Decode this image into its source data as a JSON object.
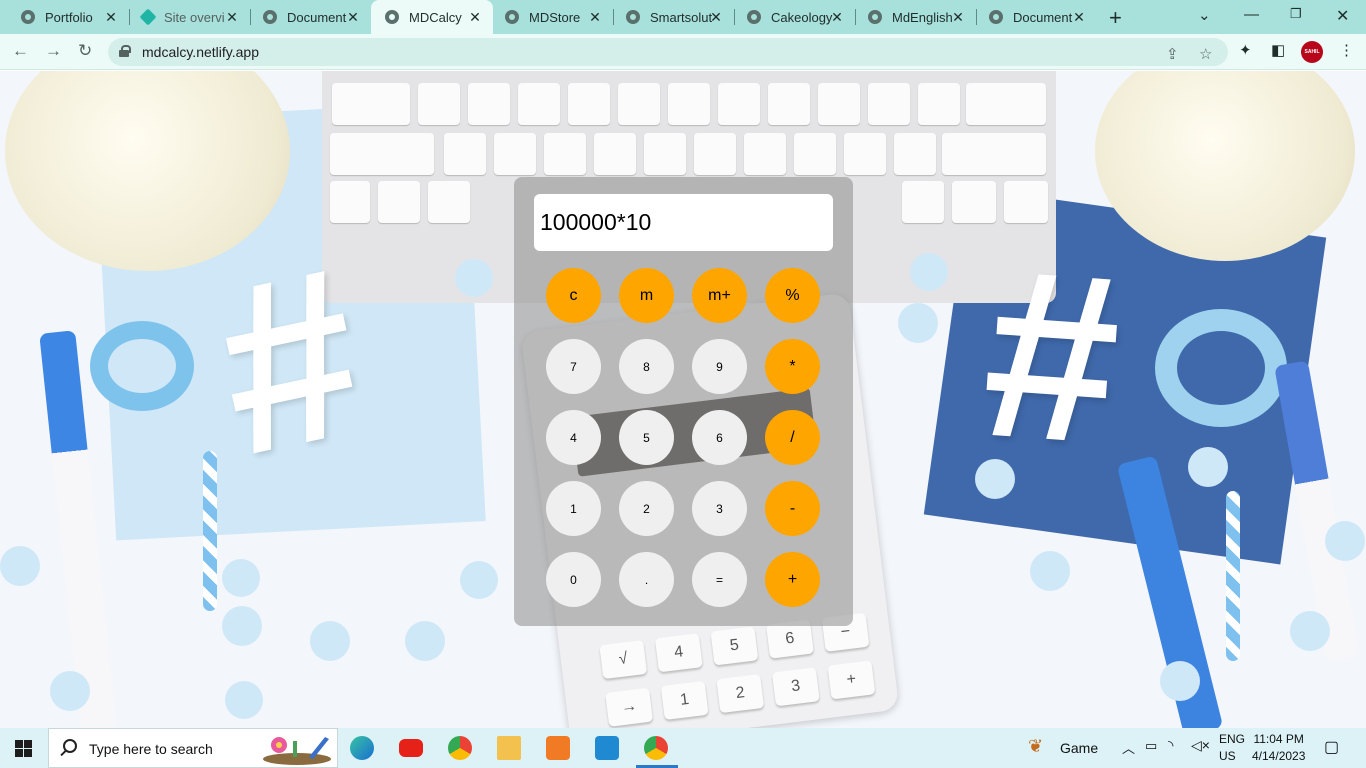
{
  "browser": {
    "tabs": [
      {
        "title": "Portfolio",
        "icon": "globe-icon",
        "active": false
      },
      {
        "title": "Site overvi",
        "icon": "netlify-icon",
        "active": false
      },
      {
        "title": "Document",
        "icon": "globe-icon",
        "active": false
      },
      {
        "title": "MDCalcy",
        "icon": "globe-icon",
        "active": true
      },
      {
        "title": "MDStore",
        "icon": "globe-icon",
        "active": false
      },
      {
        "title": "Smartsolut",
        "icon": "globe-icon",
        "active": false
      },
      {
        "title": "Cakeology",
        "icon": "globe-icon",
        "active": false
      },
      {
        "title": "MdEnglish",
        "icon": "globe-icon",
        "active": false
      },
      {
        "title": "Document",
        "icon": "globe-icon",
        "active": false
      }
    ],
    "new_tab": "+",
    "tab_close": "✕",
    "url": "mdcalcy.netlify.app",
    "profile_label": "SAHIL",
    "colors": {
      "tabbar": "#a8e0db",
      "active_tab": "#ecfbf8"
    }
  },
  "calculator": {
    "display_value": "100000*10",
    "buttons": [
      [
        "c",
        "m",
        "m+",
        "%"
      ],
      [
        "7",
        "8",
        "9",
        "*"
      ],
      [
        "4",
        "5",
        "6",
        "/"
      ],
      [
        "1",
        "2",
        "3",
        "-"
      ],
      [
        "0",
        ".",
        "=",
        "+"
      ]
    ],
    "colors": {
      "operator": "#ffa500",
      "number": "#efefef",
      "panel": "rgba(140,140,140,0.55)"
    }
  },
  "taskbar": {
    "search_placeholder": "Type here to search",
    "apps": [
      "edge-icon",
      "youtube-icon",
      "chrome-icon",
      "file-explorer-icon",
      "xampp-icon",
      "vscode-icon",
      "chrome-profile-icon"
    ],
    "game_label": "Game",
    "language_line1": "ENG",
    "language_line2": "US",
    "time": "11:04 PM",
    "date": "4/14/2023"
  }
}
